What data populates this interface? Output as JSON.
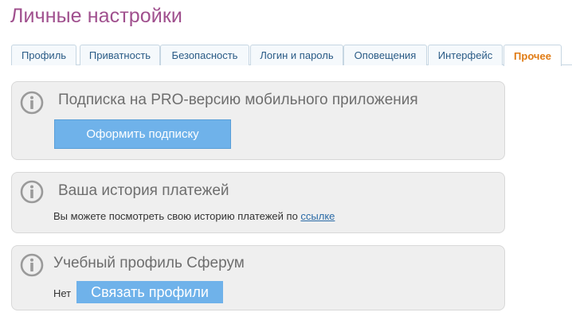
{
  "page": {
    "title": "Личные настройки"
  },
  "tabs": [
    {
      "label": "Профиль",
      "active": false
    },
    {
      "label": "Приватность",
      "active": false
    },
    {
      "label": "Безопасность",
      "active": false
    },
    {
      "label": "Логин и пароль",
      "active": false
    },
    {
      "label": "Оповещения",
      "active": false
    },
    {
      "label": "Интерфейс",
      "active": false
    },
    {
      "label": "Прочее",
      "active": true
    }
  ],
  "panels": {
    "subscription": {
      "icon": "info-icon",
      "title": "Подписка на PRO-версию мобильного приложения",
      "button_label": "Оформить подписку"
    },
    "payments": {
      "icon": "info-icon",
      "title": "Ваша история платежей",
      "text": "Вы можете посмотреть свою историю платежей по ",
      "link_label": "ссылке"
    },
    "sferum": {
      "icon": "info-icon",
      "title": "Учебный профиль Сферум",
      "status_text": "Нет",
      "button_label": "Связать профили"
    }
  },
  "colors": {
    "title": "#a0508e",
    "active_tab": "#e07b14",
    "tab_text": "#2a5b86",
    "button_bg": "#6fb2ea",
    "panel_bg": "#efefef",
    "link": "#2a6aa6"
  }
}
